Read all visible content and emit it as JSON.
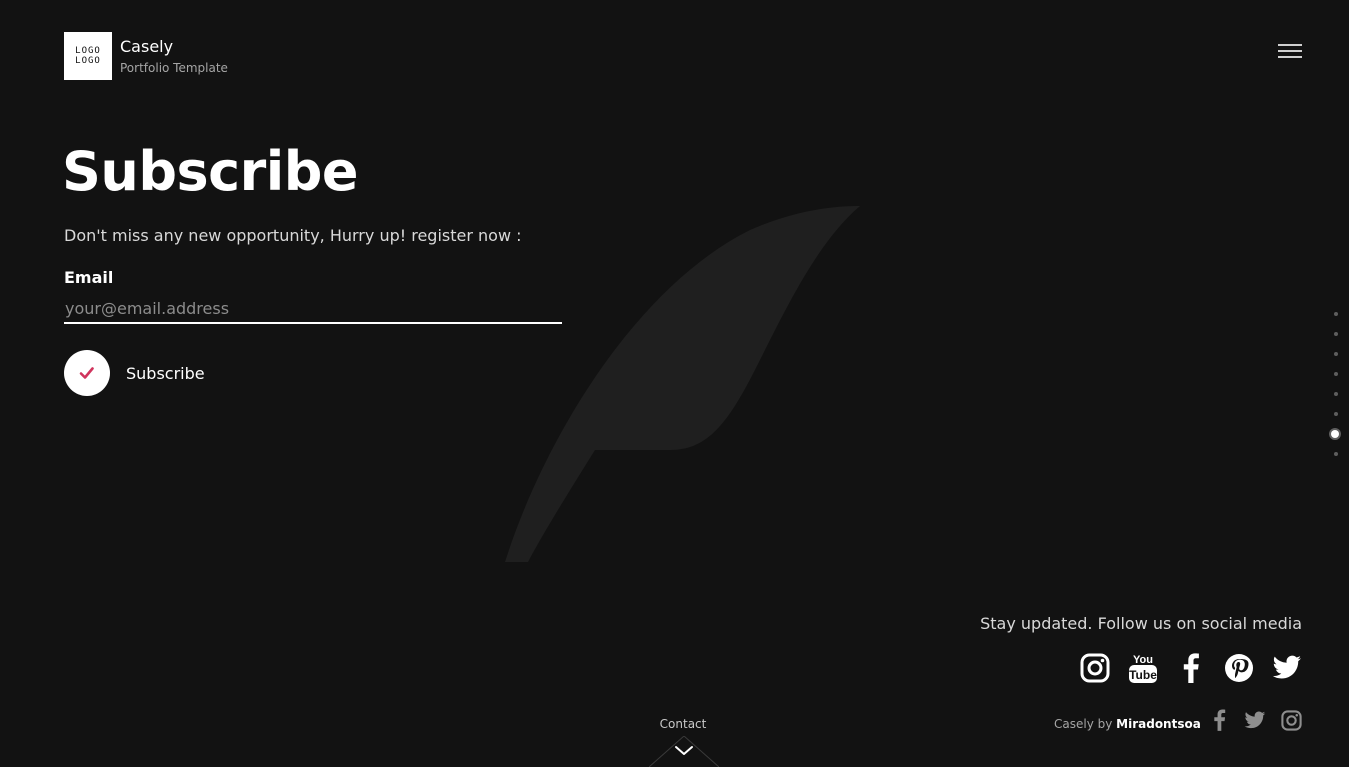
{
  "header": {
    "logo_line1": "LOGO",
    "logo_line2": "LOGO",
    "brand_name": "Casely",
    "brand_subtitle": "Portfolio Template",
    "menu_icon": "hamburger-icon"
  },
  "main": {
    "title": "Subscribe",
    "subtitle": "Don't miss any new opportunity, Hurry up! register now :",
    "email_label": "Email",
    "email_placeholder": "your@email.address",
    "email_value": "",
    "subscribe_label": "Subscribe",
    "subscribe_icon": "checkmark-icon"
  },
  "section_nav": {
    "count": 8,
    "active_index": 6
  },
  "footer": {
    "follow_text": "Stay updated. Follow us on social media",
    "social_icons": [
      "instagram-icon",
      "youtube-icon",
      "facebook-icon",
      "pinterest-icon",
      "twitter-icon"
    ],
    "credit_prefix": "Casely by ",
    "credit_author": "Miradontsoa",
    "small_icons": [
      "facebook-icon",
      "twitter-icon",
      "instagram-icon"
    ],
    "contact_label": "Contact"
  },
  "colors": {
    "background": "#121212",
    "accent": "#d0345d",
    "text": "#ffffff",
    "muted": "#a5a5a5"
  }
}
